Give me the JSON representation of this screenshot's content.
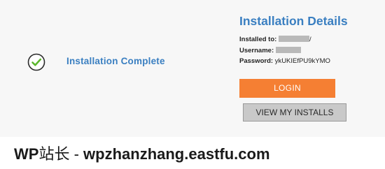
{
  "status": {
    "icon": "check-circle-icon",
    "text": "Installation Complete",
    "accent_color": "#3a7fc1"
  },
  "details": {
    "title": "Installation Details",
    "installed_to_label": "Installed to:",
    "installed_to_suffix": "/",
    "username_label": "Username:",
    "password_label": "Password:",
    "password_value": "ykUKIEfPU9kYMO"
  },
  "buttons": {
    "login_label": "LOGIN",
    "login_color": "#f57f33",
    "my_installs_label": "VIEW MY INSTALLS"
  },
  "watermark": {
    "brand": "WP",
    "cjk": "站长",
    "separator": " - ",
    "domain": "wpzhanzhang.eastfu.com"
  }
}
